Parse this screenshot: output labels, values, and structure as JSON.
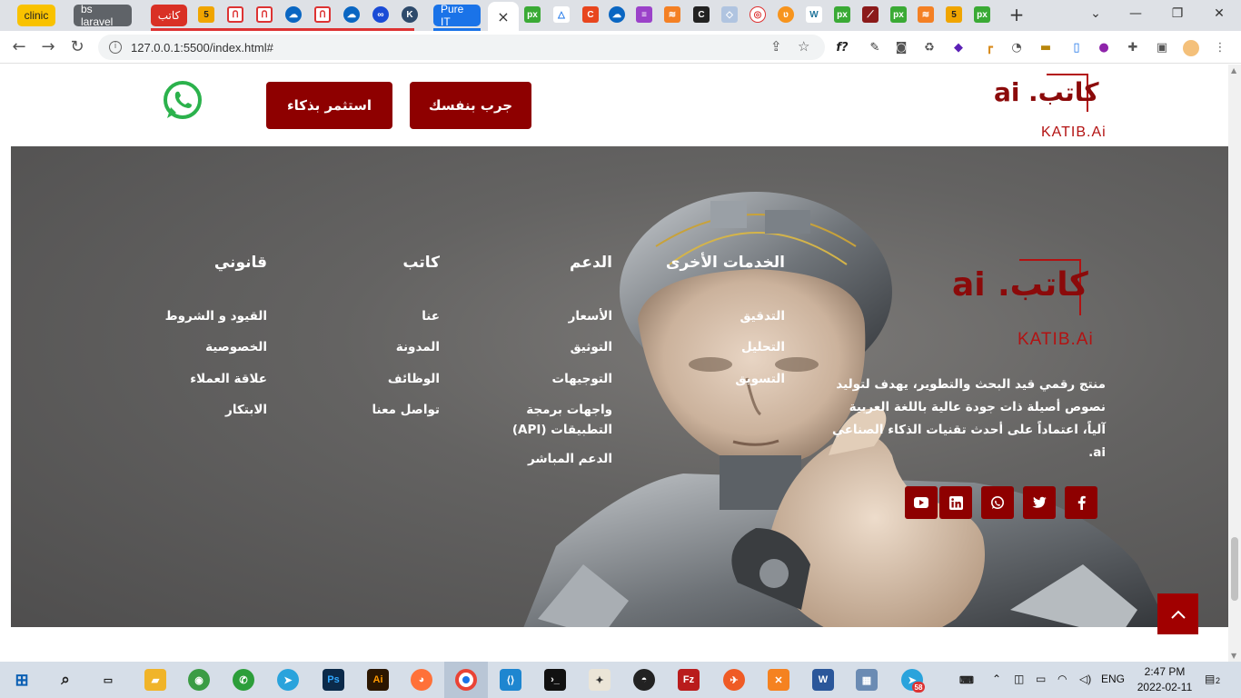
{
  "browser": {
    "tabs": [
      {
        "label": "clinic",
        "color": "#f9c200",
        "text_color": "#222"
      },
      {
        "label": "bs laravel",
        "color": "#5f6368",
        "text_color": "#fff"
      },
      {
        "label": "كاتب",
        "color": "#d93025",
        "text_color": "#fff"
      },
      {
        "label": "Pure IT",
        "color": "#1a73e8",
        "text_color": "#fff"
      }
    ],
    "active_tab_close": "×",
    "new_tab": "+",
    "url": "127.0.0.1:5500/index.html#",
    "window_controls": {
      "minimize": "—",
      "maximize": "❐",
      "close": "✕"
    }
  },
  "header": {
    "logo": {
      "arabic": "كاتب.",
      "ai": "ai",
      "latin": "KATIB.Ai"
    },
    "try_button": "جرب بنفسك",
    "invest_button": "استثمر بذكاء"
  },
  "footer": {
    "logo": {
      "arabic": "كاتب.",
      "ai": "ai",
      "latin": "KATIB.Ai"
    },
    "description": "منتج رقمي قيد البحث والتطوير، يهدف لتوليد نصوص أصيلة ذات جودة عالية باللغة العربية آلياً، اعتماداً على أحدث تقنيات الذكاء الصناعي ai.",
    "columns": {
      "services": {
        "title": "الخدمات الأخرى",
        "links": [
          "التدقيق",
          "التحليل",
          "التسويق"
        ]
      },
      "support": {
        "title": "الدعم",
        "links": [
          "الأسعار",
          "التوثيق",
          "التوجيهات",
          "واجهات برمجة التطبيقات (API)",
          "الدعم المباشر"
        ]
      },
      "katib": {
        "title": "كاتب",
        "links": [
          "عنا",
          "المدونة",
          "الوظائف",
          "تواصل معنا"
        ]
      },
      "legal": {
        "title": "قانوني",
        "links": [
          "القيود و الشروط",
          "الخصوصية",
          "علاقة العملاء",
          "الابتكار"
        ]
      }
    },
    "social": [
      "youtube-icon",
      "linkedin-icon",
      "whatsapp-icon",
      "twitter-icon",
      "facebook-icon"
    ],
    "accent": "#8e0000"
  },
  "taskbar": {
    "time": "2:47 PM",
    "date": "2022-02-11",
    "lang": "ENG",
    "notifications": "2",
    "telegram_badge": "58"
  }
}
